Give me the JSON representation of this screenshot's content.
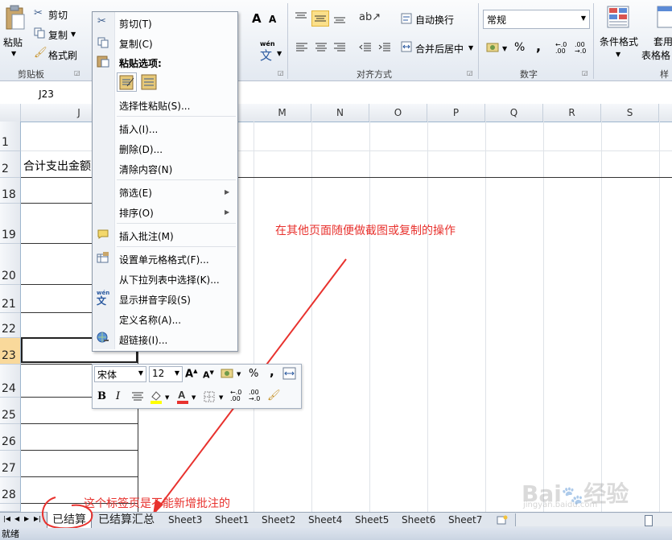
{
  "ribbon": {
    "clipboard": {
      "paste": "粘贴",
      "cut": "剪切",
      "copy": "复制",
      "format_painter": "格式刷",
      "label": "剪贴板"
    },
    "font": {
      "grow": "A",
      "shrink": "A",
      "wen": "wén",
      "wen_char": "文"
    },
    "alignment": {
      "wrap": "自动换行",
      "merge": "合并后居中",
      "label": "对齐方式"
    },
    "number": {
      "format": "常规",
      "percent": "%",
      "comma": ",",
      "label": "数字"
    },
    "styles": {
      "conditional": "条件格式",
      "table_format": "套用",
      "table_format2": "表格格",
      "label": "样"
    }
  },
  "namebox": "J23",
  "columns": [
    "J",
    "M",
    "N",
    "O",
    "P",
    "Q",
    "R",
    "S"
  ],
  "rows": [
    {
      "num": "1"
    },
    {
      "num": "2",
      "text": "合计支出金额"
    },
    {
      "num": "18"
    },
    {
      "num": "19"
    },
    {
      "num": "20"
    },
    {
      "num": "21"
    },
    {
      "num": "22"
    },
    {
      "num": "23"
    },
    {
      "num": "24"
    },
    {
      "num": "25"
    },
    {
      "num": "26"
    },
    {
      "num": "27"
    },
    {
      "num": "28"
    }
  ],
  "context_menu": {
    "cut": "剪切(T)",
    "copy": "复制(C)",
    "paste_options": "粘贴选项:",
    "paste_special": "选择性粘贴(S)...",
    "insert": "插入(I)...",
    "delete": "删除(D)...",
    "clear": "清除内容(N)",
    "filter": "筛选(E)",
    "sort": "排序(O)",
    "insert_comment": "插入批注(M)",
    "format_cells": "设置单元格格式(F)...",
    "pick_list": "从下拉列表中选择(K)...",
    "phonetic": "显示拼音字段(S)",
    "define_name": "定义名称(A)...",
    "hyperlink": "超链接(I)..."
  },
  "mini_toolbar": {
    "font": "宋体",
    "size": "12",
    "percent": "%",
    "comma": ","
  },
  "annotations": {
    "note1": "在其他页面随便做截图或复制的操作",
    "note2": "这个标签页是不能新增批注的",
    "colors": {
      "red": "#e8322e"
    }
  },
  "tabs": [
    "已结算",
    "已结算汇总",
    "Sheet3",
    "Sheet1",
    "Sheet2",
    "Sheet4",
    "Sheet5",
    "Sheet6",
    "Sheet7"
  ],
  "status": "就绪",
  "watermark": "Baidu经验"
}
